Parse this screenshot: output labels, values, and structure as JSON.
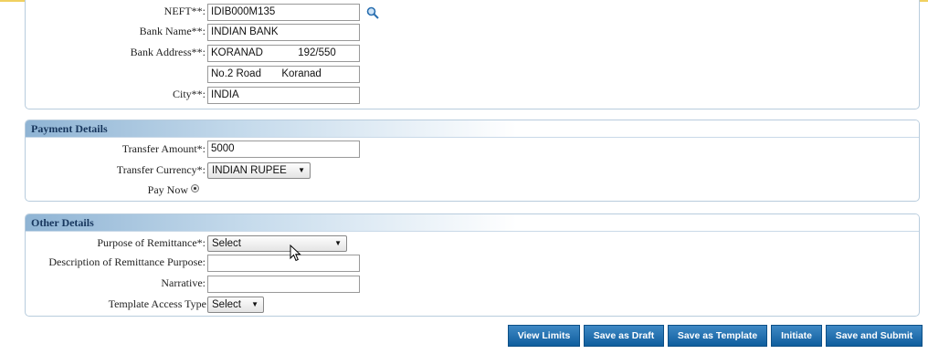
{
  "beneficiary": {
    "neft_label": "NEFT**:",
    "neft_value": "IDIB000M135",
    "search_icon": "magnifier-icon",
    "bank_name_label": "Bank Name**:",
    "bank_name_value": "INDIAN BANK",
    "bank_address_label": "Bank Address**:",
    "bank_address_line1": "KORANAD            192/550",
    "bank_address_line2": "No.2 Road       Koranad",
    "city_label": "City**:",
    "city_value": "INDIA"
  },
  "payment": {
    "title": "Payment Details",
    "amount_label": "Transfer Amount*:",
    "amount_value": "5000",
    "currency_label": "Transfer Currency*:",
    "currency_value": "INDIAN RUPEE",
    "pay_now_label": "Pay Now"
  },
  "other": {
    "title": "Other Details",
    "purpose_label": "Purpose of Remittance*:",
    "purpose_value": "Select",
    "description_label": "Description of Remittance Purpose:",
    "description_value": "",
    "narrative_label": "Narrative:",
    "narrative_value": "",
    "template_label": "Template Access Type",
    "template_value": "Select"
  },
  "buttons": {
    "view_limits": "View Limits",
    "save_draft": "Save as Draft",
    "save_template": "Save as Template",
    "initiate": "Initiate",
    "save_submit": "Save and Submit"
  },
  "colors": {
    "header_text": "#17365d",
    "button_bg": "#1a6aab",
    "top_line": "#f0d060"
  }
}
